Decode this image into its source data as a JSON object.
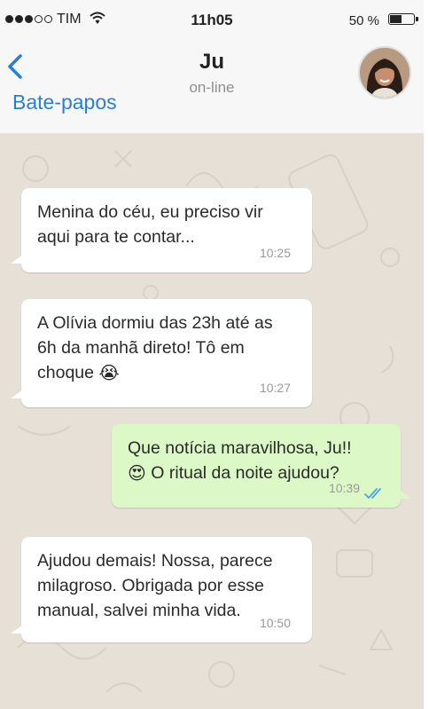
{
  "status_bar": {
    "carrier": "TIM",
    "time": "11h05",
    "battery": "50 %"
  },
  "header": {
    "back_label": "Bate-papos",
    "contact_name": "Ju",
    "contact_status": "on-line"
  },
  "messages": [
    {
      "direction": "in",
      "lines": [
        "Menina do céu, eu preciso vir",
        "aqui para te contar..."
      ],
      "time": "10:25"
    },
    {
      "direction": "in",
      "lines": [
        "A Olívia dormiu das 23h até as",
        "6h da manhã direto! Tô em",
        "choque"
      ],
      "emoji": "😭",
      "time": "10:27"
    },
    {
      "direction": "out",
      "lines": [
        "Que notícia maravilhosa, Ju!!",
        "O ritual da noite ajudou?"
      ],
      "emoji": "😍",
      "time": "10:39",
      "read": true
    },
    {
      "direction": "in",
      "lines": [
        "Ajudou demais! Nossa, parece",
        "milagroso. Obrigada por esse",
        "manual, salvei minha vida."
      ],
      "time": "10:50"
    }
  ],
  "colors": {
    "accent": "#2a7fd4",
    "outgoing_bubble": "#dcf8c6",
    "chat_background": "#e6e0d6",
    "read_ticks": "#4fa3e0"
  }
}
